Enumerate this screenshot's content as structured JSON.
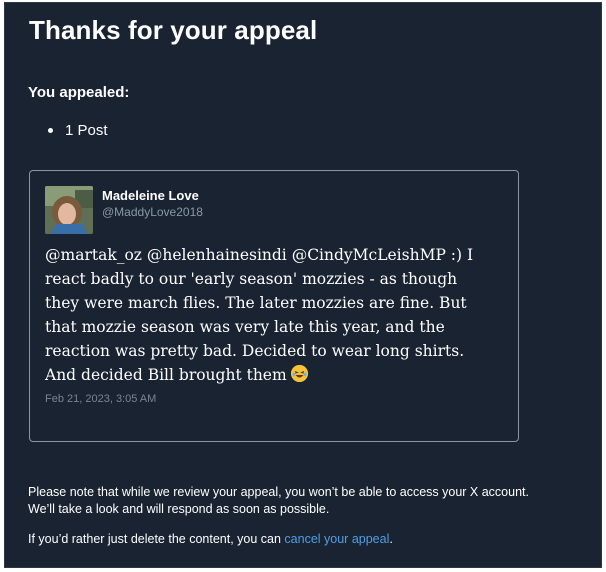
{
  "page": {
    "title": "Thanks for your appeal",
    "appealed_label": "You appealed:",
    "appeal_items": [
      "1 Post"
    ]
  },
  "post": {
    "author_name": "Madeleine Love",
    "author_handle": "@MaddyLove2018",
    "text": "@martak_oz @helenhainesindi @CindyMcLeishMP :) I react badly to our 'early season' mozzies - as though they were march flies. The later mozzies are fine. But that mozzie season was very late this year, and the reaction was pretty bad. Decided to wear long shirts. And decided Bill brought them",
    "emoji": "laughing-face-emoji",
    "date": "Feb 21, 2023, 3:05 AM"
  },
  "footer": {
    "note_line1": "Please note that while we review your appeal, you won’t be able to access your X account.",
    "note_line2": "We’ll take a look and will respond as soon as possible.",
    "delete_prefix": "If you’d rather just delete the content, you can ",
    "cancel_link": "cancel your appeal",
    "delete_suffix": "."
  },
  "colors": {
    "background": "#1a2332",
    "text": "#ffffff",
    "muted": "#8b98a5",
    "link": "#4f9fe6",
    "card_border": "#8b96a3"
  }
}
